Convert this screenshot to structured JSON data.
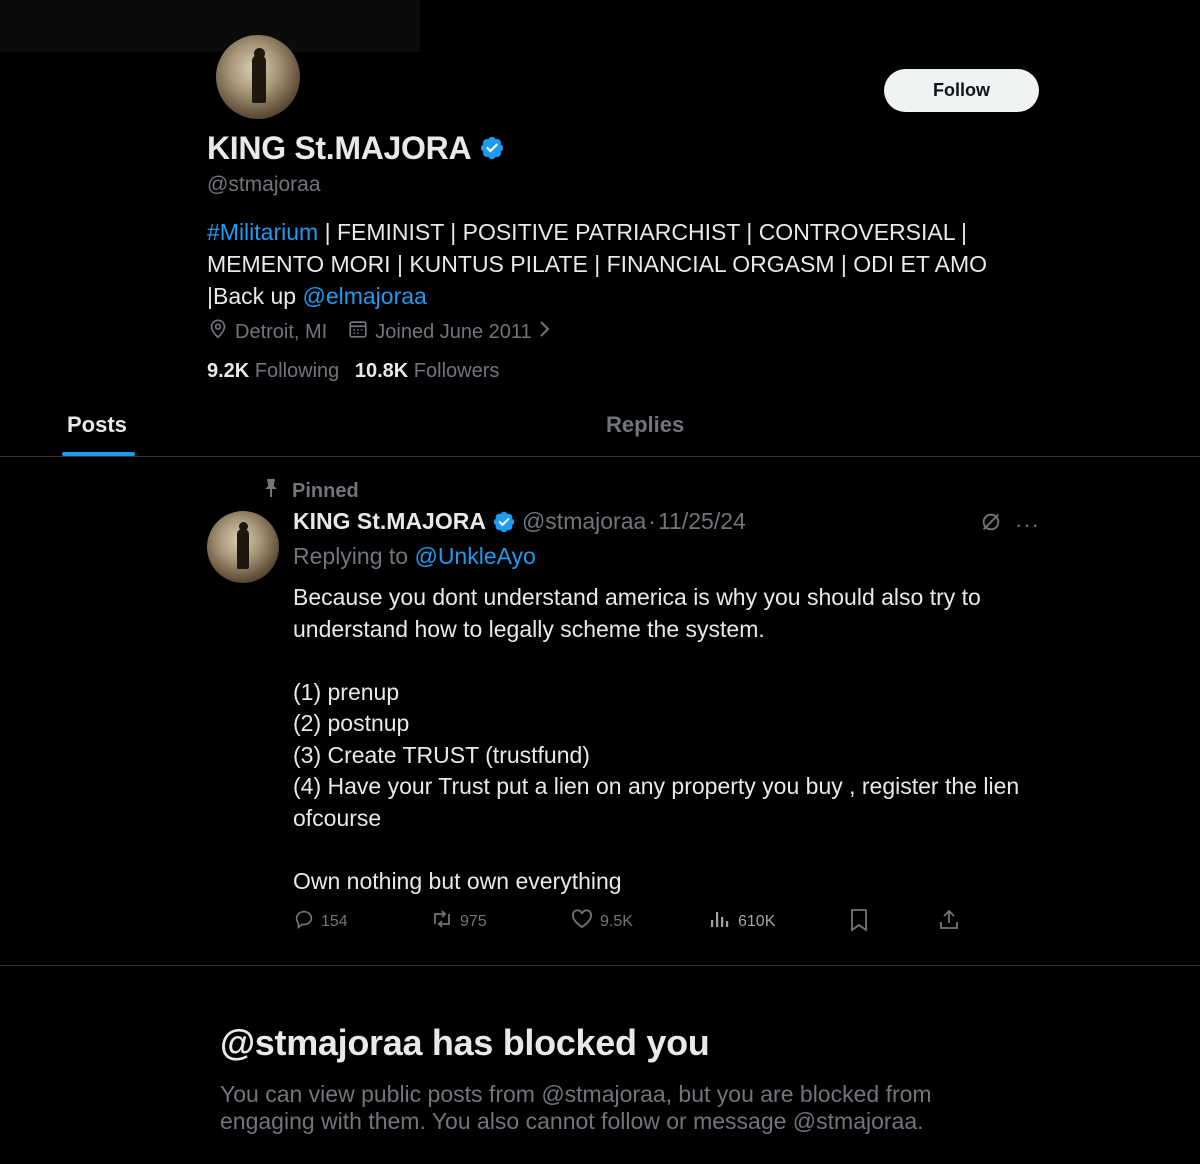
{
  "profile": {
    "name": "KING St.MAJORA",
    "handle": "@stmajoraa",
    "follow_label": "Follow",
    "bio": {
      "hashtag": "#Militarium",
      "text": " | FEMINIST | POSITIVE PATRIARCHIST | CONTROVERSIAL | MEMENTO MORI | KUNTUS PILATE | FINANCIAL ORGASM | ODI ET AMO |Back up ",
      "mention": "@elmajoraa"
    },
    "location": "Detroit, MI",
    "joined": "Joined June 2011",
    "following_count": "9.2K",
    "following_label": "Following",
    "followers_count": "10.8K",
    "followers_label": "Followers"
  },
  "tabs": [
    {
      "label": "Posts",
      "active": true
    },
    {
      "label": "Replies",
      "active": false
    }
  ],
  "post": {
    "pinned_label": "Pinned",
    "author_name": "KING St.MAJORA",
    "author_handle": "@stmajoraa",
    "separator": "·",
    "date": "11/25/24",
    "replying_prefix": "Replying to ",
    "replying_to": "@UnkleAyo",
    "body": {
      "line1": "Because you dont understand america is why you should also try to understand how to legally scheme the system.",
      "item1": "(1) prenup",
      "item2": "(2) postnup",
      "item3": "(3) Create TRUST (trustfund)",
      "item4": "(4) Have your Trust put a lien on any property you buy , register the lien ofcourse",
      "closing": "Own nothing but own everything"
    },
    "stats": {
      "replies": "154",
      "reposts": "975",
      "likes": "9.5K",
      "views": "610K"
    },
    "icons": [
      "grok-icon",
      "more-icon",
      "reply-icon",
      "repost-icon",
      "like-icon",
      "views-icon",
      "bookmark-icon",
      "share-icon"
    ]
  },
  "blocked": {
    "title": "@stmajoraa has blocked you",
    "message": "You can view public posts from @stmajoraa, but you are blocked from engaging with them. You also cannot follow or message @stmajoraa."
  },
  "colors": {
    "background": "#000000",
    "text": "#e7e9ea",
    "muted": "#71767b",
    "accent": "#1d9bf0",
    "border": "#2f3336"
  }
}
